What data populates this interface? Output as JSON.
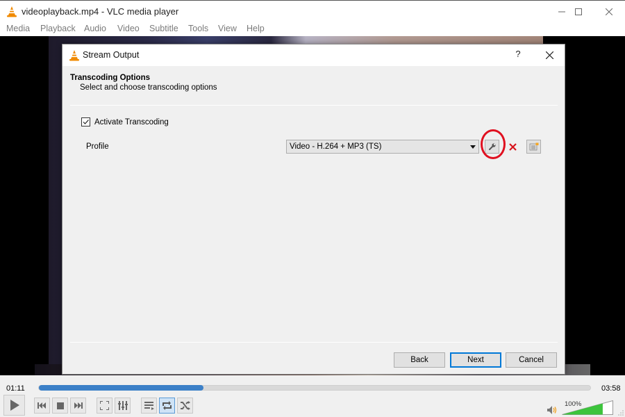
{
  "window": {
    "title": "videoplayback.mp4 - VLC media player",
    "icon": "vlc-cone-icon",
    "controls": [
      "minimize-icon",
      "maximize-icon",
      "close-icon"
    ]
  },
  "menu": [
    {
      "label": "Media"
    },
    {
      "label": "Playback"
    },
    {
      "label": "Audio"
    },
    {
      "label": "Video"
    },
    {
      "label": "Subtitle"
    },
    {
      "label": "Tools"
    },
    {
      "label": "View"
    },
    {
      "label": "Help"
    }
  ],
  "dialog": {
    "title": "Stream Output",
    "help_label": "?",
    "section_title": "Transcoding Options",
    "section_subtitle": "Select and choose transcoding options",
    "activate_label": "Activate Transcoding",
    "activate_checked": true,
    "profile_label": "Profile",
    "profile_value": "Video - H.264 + MP3 (TS)",
    "profile_tools": [
      {
        "name": "edit-profile",
        "icon": "wrench-icon",
        "highlighted": true
      },
      {
        "name": "delete-profile",
        "icon": "red-x-icon"
      },
      {
        "name": "new-profile",
        "icon": "new-list-icon"
      }
    ],
    "buttons": {
      "back": "Back",
      "next": "Next",
      "cancel": "Cancel"
    },
    "highlight_color": "#e01020"
  },
  "player": {
    "elapsed": "01:11",
    "total": "03:58",
    "progress_fraction": 0.298,
    "volume_label": "100%",
    "volume_fraction": 1.0,
    "accent_color": "#3c80c8",
    "buttons": [
      {
        "name": "play",
        "icon": "play-icon"
      },
      {
        "name": "previous",
        "icon": "previous-icon"
      },
      {
        "name": "stop",
        "icon": "stop-icon"
      },
      {
        "name": "next",
        "icon": "next-icon"
      },
      {
        "name": "fullscreen",
        "icon": "fullscreen-icon"
      },
      {
        "name": "extended-settings",
        "icon": "equalizer-icon"
      },
      {
        "name": "playlist",
        "icon": "playlist-icon"
      },
      {
        "name": "loop",
        "icon": "loop-icon",
        "active": true
      },
      {
        "name": "random",
        "icon": "shuffle-icon"
      }
    ]
  }
}
